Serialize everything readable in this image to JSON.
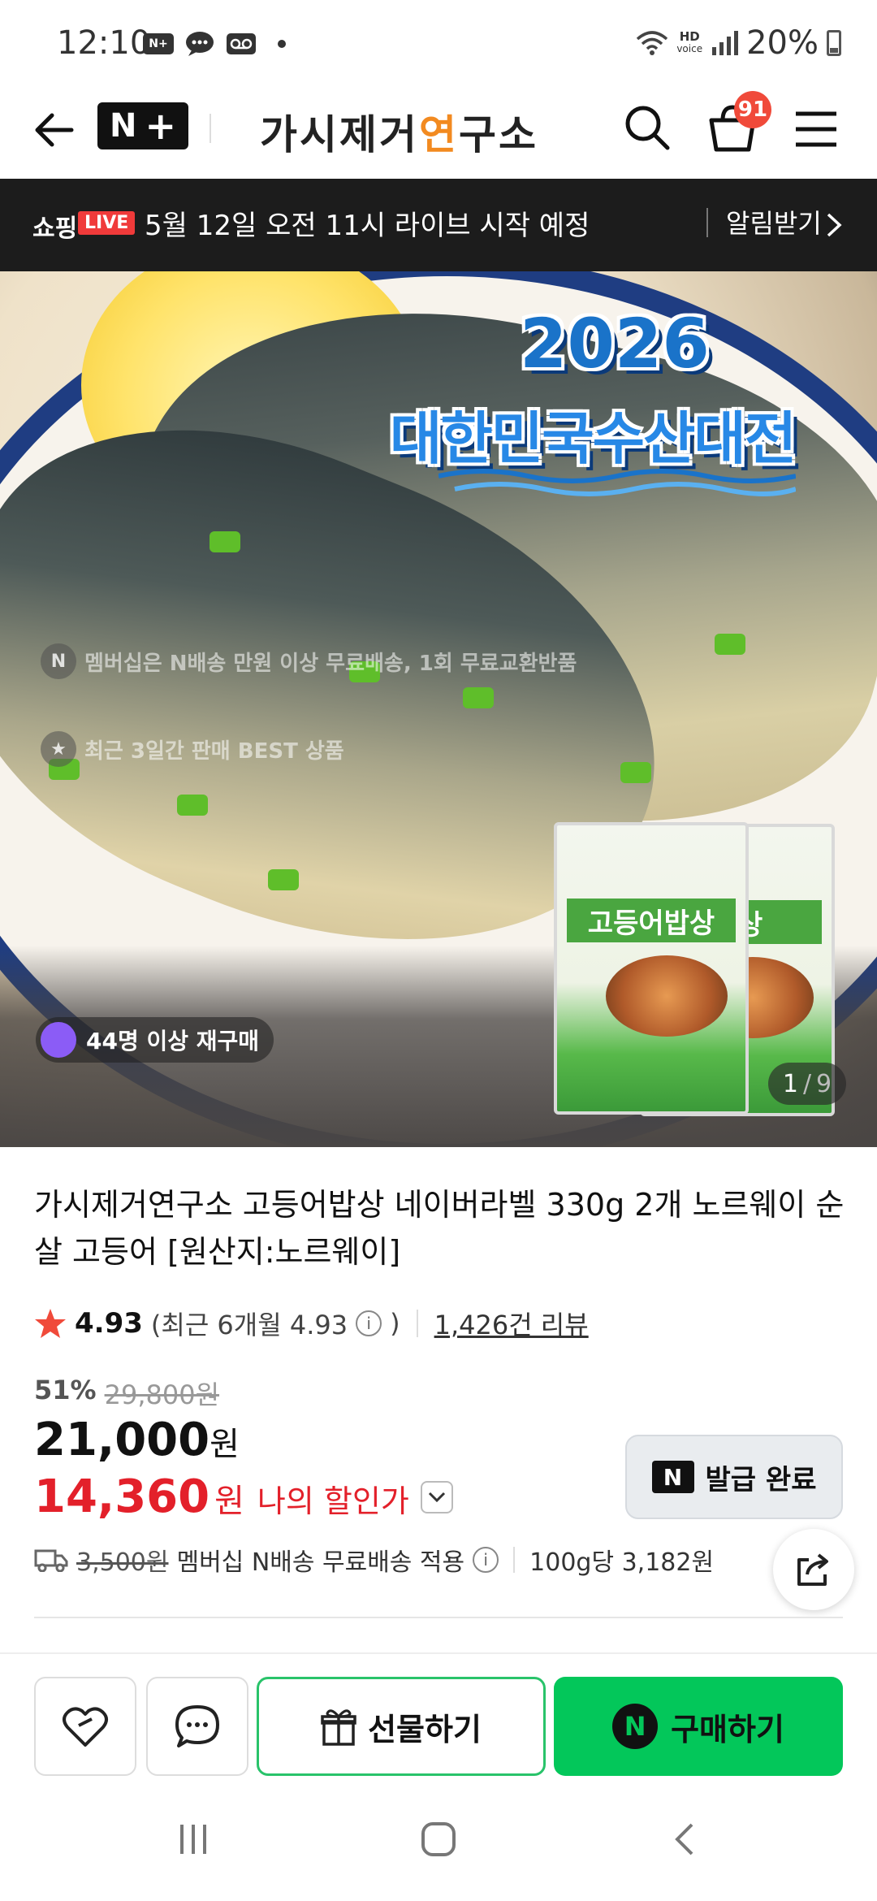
{
  "status_bar": {
    "time": "12:10",
    "icon1": "N+",
    "hd": "HD",
    "voice": "voice",
    "battery": "20%"
  },
  "header": {
    "nplus_label": "N",
    "nplus_plus": "+",
    "brand_a": "가시제거",
    "brand_b": "연",
    "brand_c": "구소",
    "cart_count": "91"
  },
  "live": {
    "shopping": "쇼핑",
    "tag": "LIVE",
    "message": "5월 12일 오전 11시 라이브 시작 예정",
    "alarm": "알림받기"
  },
  "hero": {
    "event_year": "2026",
    "event_name": "대한민국수산대전",
    "note_membership": "멤버십은 N배송 만원 이상 무료배송, 1회 무료교환반품",
    "repeat_buyers": "44명 이상 재구매",
    "note_best": "최근 3일간 판매 BEST 상품",
    "pack_label": "고등어밥상",
    "pack_label_short": "밥상",
    "image_index": "1",
    "image_total": "9"
  },
  "product": {
    "title": "가시제거연구소 고등어밥상 네이버라벨 330g 2개 노르웨이 순살 고등어 [원산지:노르웨이]",
    "rating": "4.93",
    "rating_sub_open": "(최근 6개월 4.93",
    "rating_sub_close": ")",
    "reviews": "1,426건 리뷰",
    "discount_pct": "51%",
    "original_price": "29,800원",
    "price": "21,000",
    "won": "원",
    "my_price": "14,360",
    "my_price_label": "나의 할인가",
    "coupon_button": "발급 완료",
    "shipping_strike": "3,500원",
    "shipping_text": "멤버십 N배송 무료배송 적용",
    "unit_price": "100g당 3,182원"
  },
  "bottom_bar": {
    "gift": "선물하기",
    "buy": "구매하기",
    "buy_badge": "N"
  },
  "colors": {
    "naver_green": "#03c75a",
    "discount_red": "#e3202a",
    "badge_red": "#f04a3a",
    "live_bg": "#1c1c1c"
  }
}
